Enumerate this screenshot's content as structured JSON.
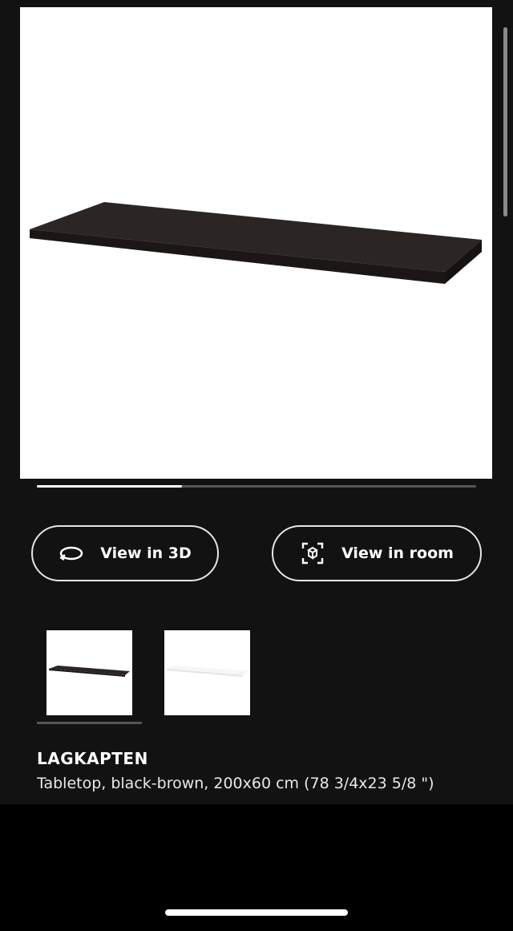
{
  "gallery": {
    "main_image_alt": "Black-brown tabletop",
    "progress": 0.33,
    "colors": {
      "tabletop": "#2a2523",
      "tabletop_edge": "#1a1615",
      "white_variant": "#f4f4f4"
    }
  },
  "actions": {
    "view_3d": {
      "label": "View in 3D",
      "icon": "rotate-3d-icon"
    },
    "view_room": {
      "label": "View in room",
      "icon": "ar-cube-icon"
    }
  },
  "variants": [
    {
      "name": "black-brown",
      "selected": true
    },
    {
      "name": "white",
      "selected": false
    }
  ],
  "product": {
    "name": "LAGKAPTEN",
    "description": "Tabletop, black-brown, 200x60 cm (78 3/4x23 5/8 \")"
  }
}
